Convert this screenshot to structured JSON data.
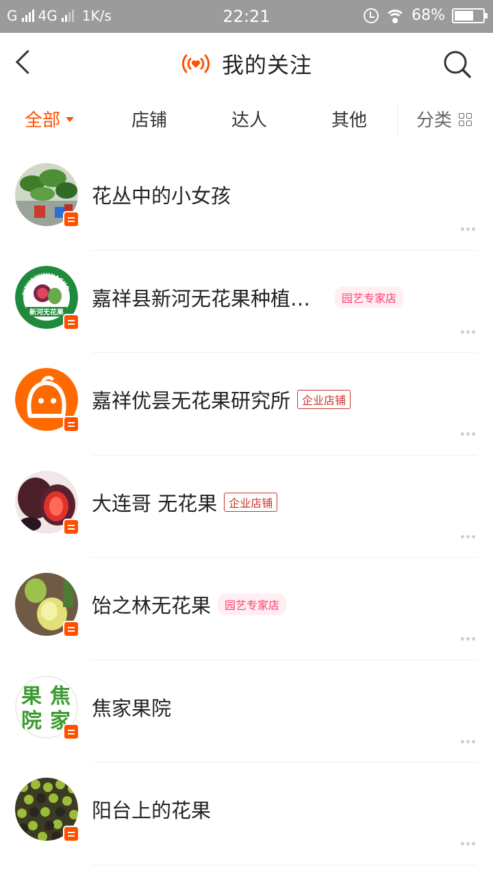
{
  "status_bar": {
    "carrier": "G",
    "network": "4G",
    "speed": "1K/s",
    "time": "22:21",
    "battery": "68%",
    "battery_level": 0.68
  },
  "header": {
    "title": "我的关注"
  },
  "tabs": [
    {
      "label": "全部",
      "active": true
    },
    {
      "label": "店铺",
      "active": false
    },
    {
      "label": "达人",
      "active": false
    },
    {
      "label": "其他",
      "active": false
    },
    {
      "label": "分类",
      "active": false
    }
  ],
  "follows": [
    {
      "name": "花丛中的小女孩",
      "tag": ""
    },
    {
      "name": "嘉祥县新河无花果种植…",
      "tag": "园艺专家店"
    },
    {
      "name": "嘉祥优昙无花果研究所",
      "tag": "企业店铺"
    },
    {
      "name": "大连哥 无花果",
      "tag": "企业店铺"
    },
    {
      "name": "饴之林无花果",
      "tag": "园艺专家店"
    },
    {
      "name": "焦家果院",
      "tag": ""
    },
    {
      "name": "阳台上的花果",
      "tag": ""
    }
  ],
  "avatar_text": {
    "xinhe_ring": "XINHEWUHUAGUO",
    "xinhe_bottom": "新河无花果",
    "jiaojia": [
      "果",
      "焦",
      "院",
      "家"
    ]
  },
  "colors": {
    "accent": "#ff5000",
    "pink_tag": "#ff3f6e",
    "red_tag": "#c8332b",
    "status_bar": "#9b9b9b"
  }
}
